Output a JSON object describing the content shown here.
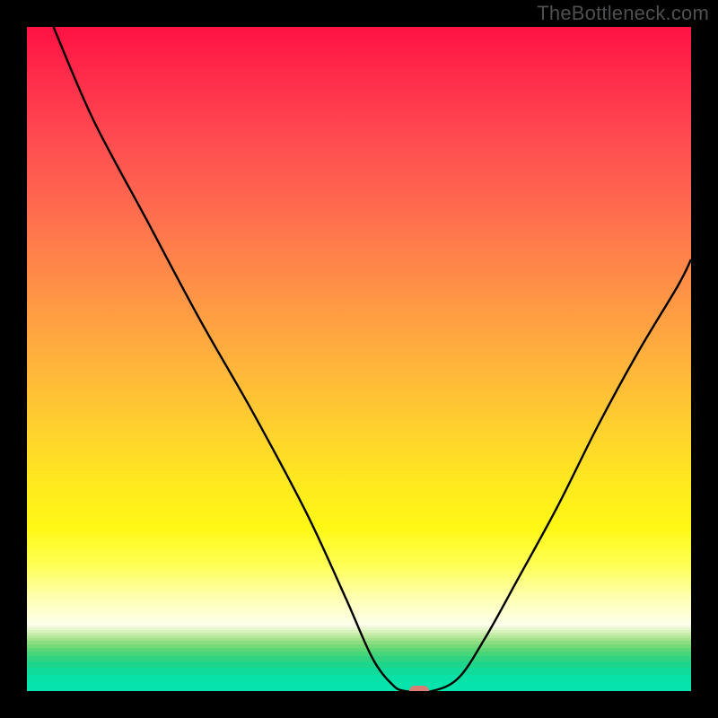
{
  "watermark": "TheBottleneck.com",
  "chart_data": {
    "type": "line",
    "title": "",
    "xlabel": "",
    "ylabel": "",
    "xlim": [
      0,
      100
    ],
    "ylim": [
      0,
      100
    ],
    "x": [
      4,
      10,
      18,
      26,
      34,
      42,
      48,
      52,
      55,
      57,
      61,
      65,
      69,
      74,
      80,
      86,
      92,
      98,
      100
    ],
    "y": [
      100,
      86,
      71,
      56,
      42,
      27,
      14,
      5,
      1,
      0,
      0,
      2,
      8,
      17,
      28,
      40,
      51,
      61,
      65
    ],
    "marker": {
      "x": 59,
      "y": 0
    },
    "notes": "V-shaped bottleneck curve over vertical red→yellow→green gradient. No axes, ticks, or legend."
  }
}
